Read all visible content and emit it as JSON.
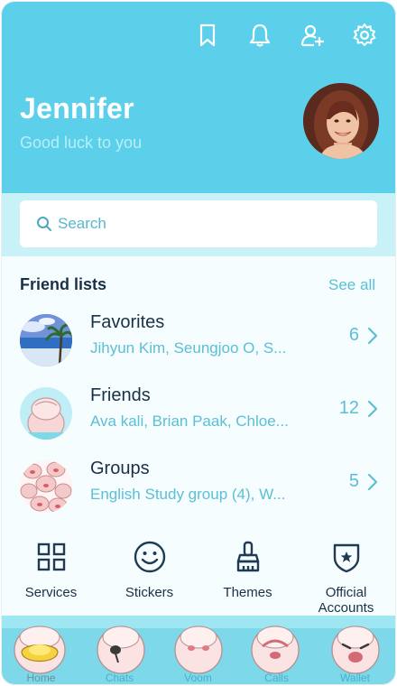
{
  "header": {
    "name": "Jennifer",
    "status_message": "Good luck to you",
    "colors": {
      "background": "#5cd0ea",
      "accent": "#5bbfd6"
    },
    "icons": [
      "bookmark-icon",
      "bell-icon",
      "add-friend-icon",
      "gear-icon"
    ]
  },
  "search": {
    "placeholder": "Search"
  },
  "friend_lists": {
    "title": "Friend lists",
    "see_all": "See all",
    "items": [
      {
        "title": "Favorites",
        "members": "Jihyun Kim, Seungjoo O, S...",
        "count": "6"
      },
      {
        "title": "Friends",
        "members": "Ava kali, Brian Paak, Chloe...",
        "count": "12"
      },
      {
        "title": "Groups",
        "members": "English Study group (4), W...",
        "count": "5"
      }
    ]
  },
  "quick_menu": [
    {
      "label": "Services",
      "icon": "grid-icon"
    },
    {
      "label": "Stickers",
      "icon": "smiley-icon"
    },
    {
      "label": "Themes",
      "icon": "brush-icon"
    },
    {
      "label": "Official Accounts",
      "icon": "shield-star-icon"
    }
  ],
  "tabbar": {
    "tabs": [
      {
        "label": "Home",
        "icon": "home-icon",
        "active": true
      },
      {
        "label": "Chats",
        "icon": "speech-bubble-icon"
      },
      {
        "label": "Voom",
        "icon": "clock-icon"
      },
      {
        "label": "Calls",
        "icon": "phone-icon"
      },
      {
        "label": "Wallet",
        "icon": "wallet-icon"
      }
    ]
  }
}
